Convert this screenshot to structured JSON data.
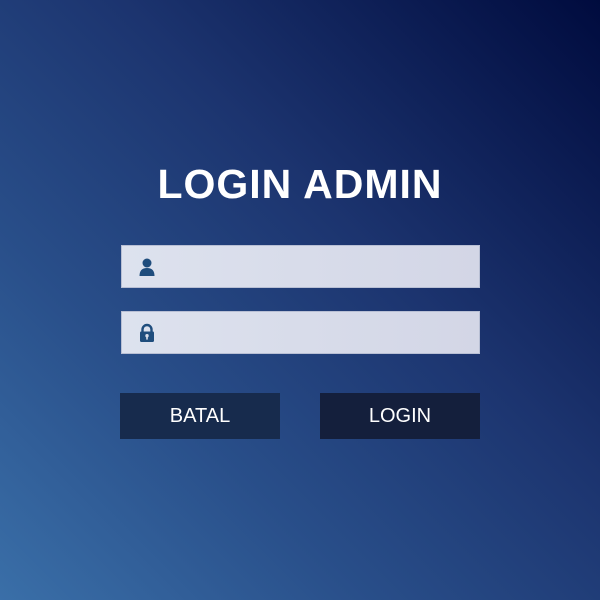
{
  "login_form": {
    "title": "LOGIN ADMIN",
    "username": {
      "value": "",
      "placeholder": "",
      "icon": "user-icon"
    },
    "password": {
      "value": "",
      "placeholder": "",
      "icon": "lock-icon"
    },
    "cancel_label": "BATAL",
    "login_label": "LOGIN"
  },
  "colors": {
    "background_start": "#3a6fa8",
    "background_end": "#000b3e",
    "field_background": "#dde2ee",
    "icon": "#1f4d7d",
    "button": "#172b4d"
  }
}
